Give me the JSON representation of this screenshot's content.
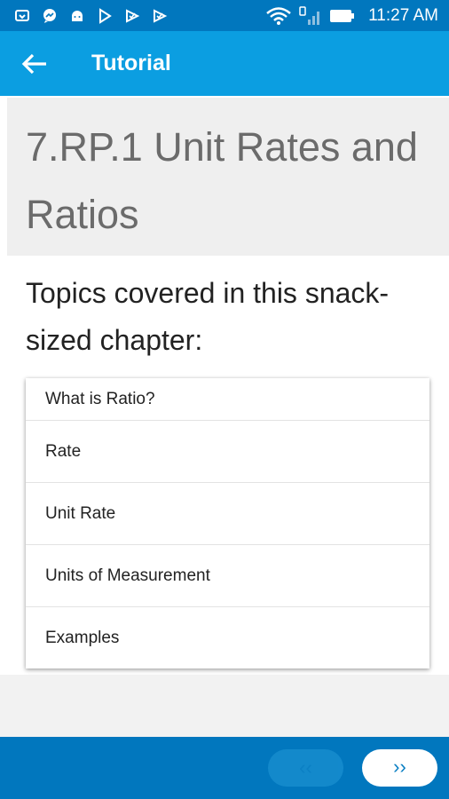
{
  "status_bar": {
    "time": "11:27 AM",
    "left_icons": [
      "notification-icon",
      "messenger-icon",
      "android-icon",
      "play-store-icon",
      "check-icon-1",
      "check-icon-2"
    ],
    "right_icons": [
      "wifi-icon",
      "signal-icon",
      "battery-icon"
    ]
  },
  "app_bar": {
    "back_icon": "back-arrow-icon",
    "title": "Tutorial"
  },
  "page": {
    "title": "7.RP.1 Unit Rates and Ratios",
    "intro": "Topics covered in this snack-sized chapter:",
    "topics": [
      {
        "label": "What is Ratio?"
      },
      {
        "label": "Rate"
      },
      {
        "label": "Unit Rate"
      },
      {
        "label": "Units of Measurement"
      },
      {
        "label": "Examples"
      }
    ]
  },
  "bottom_bar": {
    "prev_label": "‹‹",
    "next_label": "››"
  },
  "colors": {
    "status_bar": "#0177be",
    "app_bar": "#0b9ee1",
    "bottom_bar": "#0177be"
  }
}
